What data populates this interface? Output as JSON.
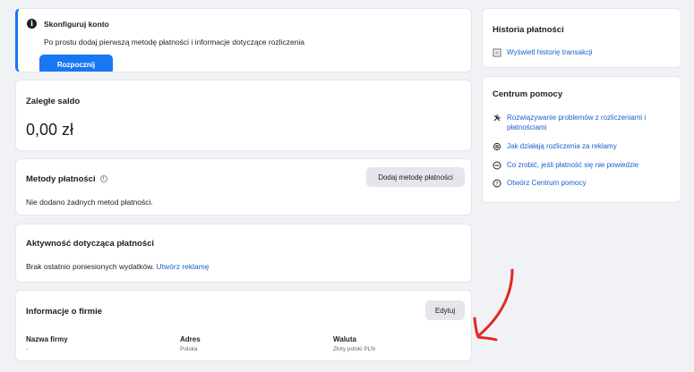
{
  "setup": {
    "title": "Skonfiguruj konto",
    "description": "Po prostu dodaj pierwszą metodę płatności i informacje dotyczące rozliczenia",
    "button": "Rozpocznij"
  },
  "balance": {
    "title": "Zaległe saldo",
    "amount": "0,00 zł"
  },
  "methods": {
    "title": "Metody płatności",
    "add_button": "Dodaj metodę płatności",
    "empty": "Nie dodano żadnych metod płatności."
  },
  "activity": {
    "title": "Aktywność dotycząca płatności",
    "text": "Brak ostatnio poniesionych wydatków.",
    "link": "Utwórz reklamę"
  },
  "company": {
    "title": "Informacje o firmie",
    "edit_button": "Edytuj",
    "columns": [
      {
        "label": "Nazwa firmy",
        "value": "-"
      },
      {
        "label": "Adres",
        "value": "Polska"
      },
      {
        "label": "Waluta",
        "value": "Złoty polski PLN"
      }
    ]
  },
  "history": {
    "title": "Historia płatności",
    "link": "Wyświetl historię transakcji",
    "icon": "receipt-icon"
  },
  "help_center": {
    "title": "Centrum pomocy",
    "links": [
      {
        "label": "Rozwiązywanie problemów z rozliczeniami i",
        "label2": "płatnościami",
        "icon": "wrench-icon"
      },
      {
        "label": "Jak działają rozliczenia za reklamy",
        "icon": "gear-icon"
      },
      {
        "label": "Co zrobić, jeśli płatność się nie powiedzie",
        "icon": "minus-circle-icon"
      },
      {
        "label": "Otwórz Centrum pomocy",
        "icon": "question-circle-icon"
      }
    ]
  },
  "colors": {
    "accent": "#1877f2",
    "link": "#1a5fcc",
    "annotation": "#e0281f"
  }
}
